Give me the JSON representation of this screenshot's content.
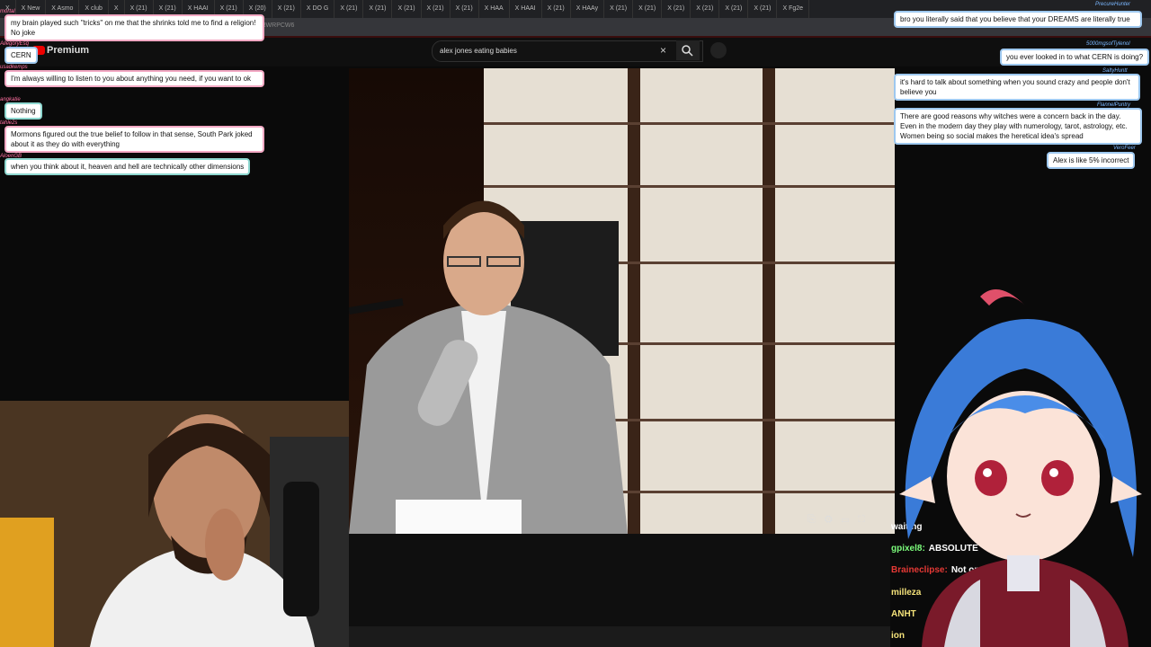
{
  "browser": {
    "tabs": [
      "",
      "New",
      "Asmo",
      "club",
      "",
      "(21)",
      "(21)",
      "HAAI",
      "(21)",
      "(20)",
      "(21)",
      "DO G",
      "(21)",
      "(21)",
      "(21)",
      "(21)",
      "(21)",
      "HAA",
      "HAAI",
      "(21)",
      "HAAy",
      "(21)",
      "(21)",
      "(21)",
      "(21)",
      "(21)",
      "(21)",
      "Fg2e"
    ],
    "address": "WRWRPCW6"
  },
  "youtube": {
    "brand": "Premium",
    "search_value": "alex jones eating babies",
    "clear_icon": "×"
  },
  "chat_left": [
    {
      "user": "mortal",
      "text": "my brain played such \"tricks\" on me that the shrinks told me to find a religion! No joke"
    },
    {
      "user": "AllegoryEsq",
      "text": "CERN"
    },
    {
      "user": "usadkemps",
      "text": "I'm always willing to listen to you about anything you need, if you want to ok"
    },
    {
      "user": "angkatie",
      "text": "Nothing"
    },
    {
      "user": "tahle2s",
      "text": "Mormons figured out the true belief to follow in that sense, South Park joked about it as they do with everything"
    },
    {
      "user": "AloenGB",
      "text": "when you think about it, heaven and hell are technically other dimensions"
    }
  ],
  "chat_right": [
    {
      "user": "PrecureHunter",
      "text": "bro you literally said that you believe that your DREAMS are literally true"
    },
    {
      "user": "5000mgsofTylenol",
      "text": "you ever looked in to what CERN is doing?"
    },
    {
      "user": "SaltyHuntt",
      "text": "it's hard to talk about something when you sound crazy and people don't believe you"
    },
    {
      "user": "FlannelPuntry",
      "text": "There are good reasons why witches were a concern back in the day. Even in the modern day they play with numerology, tarot, astrology, etc. Women being so social makes the heretical idea's spread"
    },
    {
      "user": "VeroFeer",
      "text": "Alex is like 5% incorrect"
    }
  ],
  "twitch_chat": [
    {
      "user": "waiting",
      "text": "",
      "color": "#ffffff"
    },
    {
      "user": "gpixel8:",
      "text": "ABSOLUTE",
      "color": "#7cfc7c"
    },
    {
      "user": "Braineclipse:",
      "text": "Not one",
      "color": "#e53935"
    },
    {
      "user": "milleza",
      "text": "",
      "color": "#f4e27a"
    },
    {
      "user": "ANHT",
      "text": "",
      "color": "#f4e27a"
    },
    {
      "user": "ion",
      "text": "",
      "color": "#f4e27a"
    }
  ],
  "video_controls": [
    "⎘",
    "⚙",
    "▭",
    "⛶"
  ]
}
